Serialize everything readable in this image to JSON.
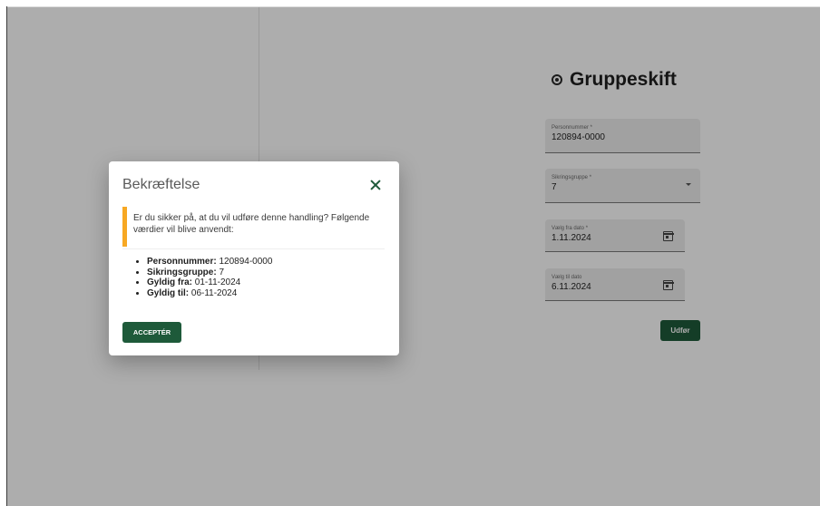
{
  "page": {
    "title": "Gruppeskift"
  },
  "form": {
    "personnummer": {
      "label": "Personnummer *",
      "value": "120894-0000"
    },
    "sikringsgruppe": {
      "label": "Sikringsgruppe *",
      "value": "7"
    },
    "valid_from": {
      "label": "Vælg fra dato *",
      "value": "1.11.2024"
    },
    "valid_to": {
      "label": "Vælg til dato",
      "value": "6.11.2024"
    },
    "submit_label": "Udfør"
  },
  "dialog": {
    "title": "Bekræftelse",
    "message": "Er du sikker på, at du vil udføre denne handling? Følgende værdier vil blive anvendt:",
    "values": [
      {
        "key": "Personnummer:",
        "value": " 120894-0000"
      },
      {
        "key": "Sikringsgruppe:",
        "value": " 7"
      },
      {
        "key": "Gyldig fra:",
        "value": " 01-11-2024"
      },
      {
        "key": "Gyldig til:",
        "value": " 06-11-2024"
      }
    ],
    "accept_label": "ACCEPTÉR"
  },
  "colors": {
    "primary": "#1e5a3a",
    "warning_accent": "#f7a823",
    "overlay": "rgba(0,0,0,0.32)"
  }
}
